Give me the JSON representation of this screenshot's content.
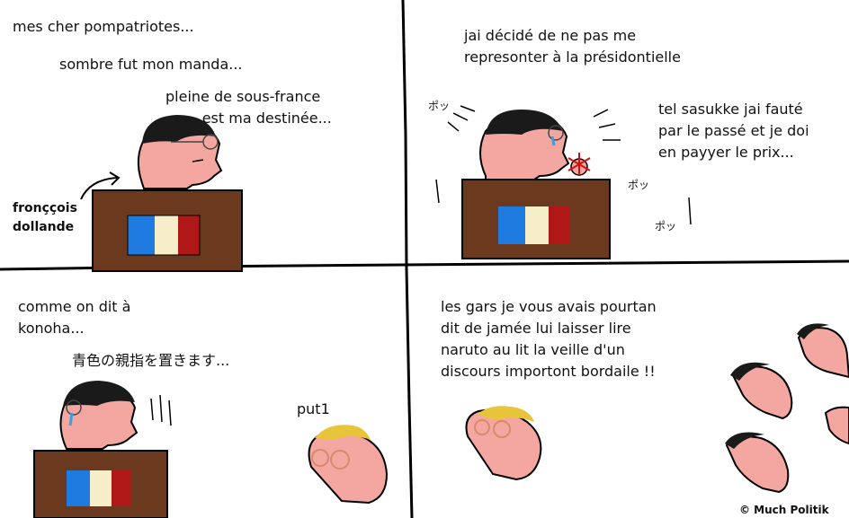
{
  "panels": {
    "top_left": {
      "line1": "mes cher pompatriotes...",
      "line2": "sombre fut mon manda...",
      "line3": "pleine de sous-france\n        est ma destinée...",
      "name_tag": "fronççois\ndollande"
    },
    "top_right": {
      "speech1": "jai décidé de ne pas me\nrepresonter à la présidontielle",
      "speech2": "tel sasukke jai fauté\npar le passé et je doi\nen payyer le prix...",
      "sfx": [
        "ポッ",
        "ポッ",
        "ポッ"
      ]
    },
    "bottom_left": {
      "speech1": "comme on dit à\nkonoha...",
      "speech2": "青色の親指を置きます...",
      "caption": "put1"
    },
    "bottom_right": {
      "speech": "les gars je vous avais pourtan\ndit de jamée lui laisser lire\nnaruto au lit la veille d'un\ndiscours importont bordaile !!",
      "credit": "© Much Politik"
    }
  },
  "colors": {
    "podium": "#6b3a1e",
    "skin": "#f3a7a0",
    "hair_dark": "#1a1a1a",
    "hair_blond": "#e8c43a",
    "glasses_red": "#d88a6a",
    "flag_blue": "#1f7be0",
    "flag_white": "#f5eec8",
    "flag_red": "#b01818",
    "tear_blue": "#39a0e0"
  },
  "icons": [
    "arrow-icon",
    "sparkle-icon"
  ]
}
